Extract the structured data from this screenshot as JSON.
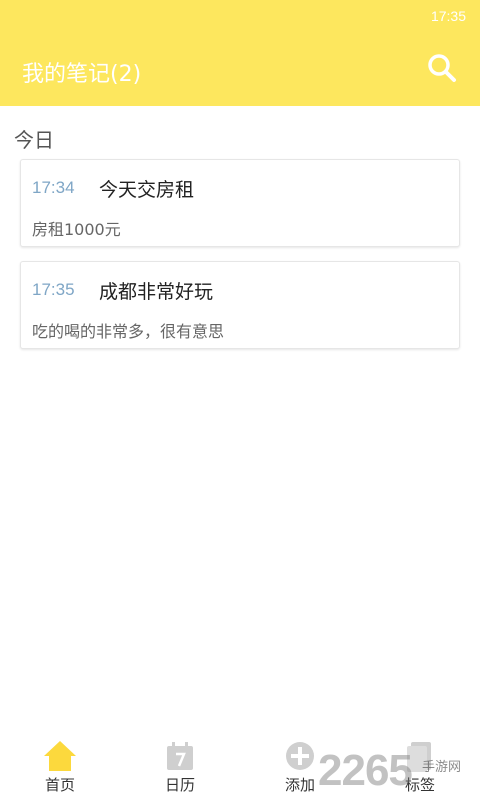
{
  "status_bar": {
    "time": "17:35"
  },
  "app_bar": {
    "title": "我的笔记(2)",
    "search_icon": "search-icon"
  },
  "section": {
    "label": "今日"
  },
  "notes": [
    {
      "time": "17:34",
      "title": "今天交房租",
      "body": "房租1000元"
    },
    {
      "time": "17:35",
      "title": "成都非常好玩",
      "body": "吃的喝的非常多，很有意思"
    }
  ],
  "tabs": [
    {
      "label": "首页",
      "icon": "home-icon",
      "active": true
    },
    {
      "label": "日历",
      "icon": "calendar-icon",
      "active": false
    },
    {
      "label": "添加",
      "icon": "add-circle-icon",
      "active": false
    },
    {
      "label": "标签",
      "icon": "tag-icon",
      "active": false
    }
  ],
  "watermark": {
    "text": "2265",
    "subtext": "手游网"
  },
  "colors": {
    "accent": "#fde75e",
    "active_icon": "#fcd93d",
    "inactive_icon": "#cfcfcf",
    "time_text": "#7fa6c6"
  }
}
